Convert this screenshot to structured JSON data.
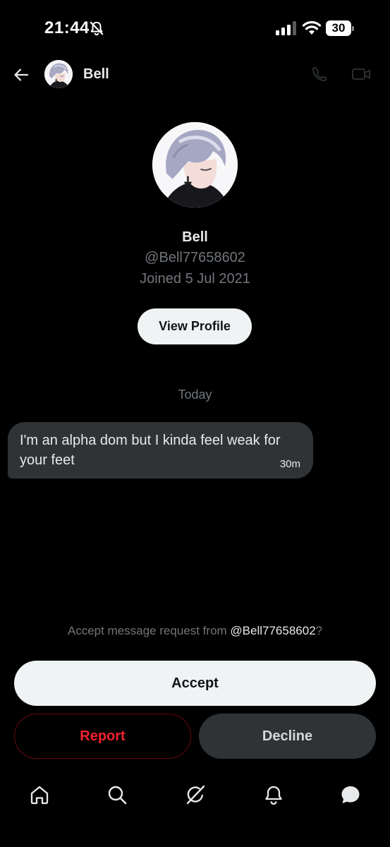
{
  "status_bar": {
    "time": "21:44",
    "battery": "30"
  },
  "header": {
    "name": "Bell"
  },
  "profile": {
    "name": "Bell",
    "handle": "@Bell77658602",
    "joined": "Joined 5 Jul 2021",
    "view_profile_label": "View Profile"
  },
  "conversation": {
    "date_separator": "Today",
    "messages": [
      {
        "text": "I'm an alpha dom but I kinda feel weak for your feet",
        "time": "30m"
      }
    ]
  },
  "request": {
    "prompt_prefix": "Accept message request from ",
    "handle": "@Bell77658602",
    "prompt_suffix": "?",
    "accept_label": "Accept",
    "report_label": "Report",
    "decline_label": "Decline"
  },
  "colors": {
    "background": "#000000",
    "bubble": "#2f3336",
    "muted_text": "#71767b",
    "report_red": "#f4212e"
  },
  "icons": {
    "status": [
      "mute-icon",
      "signal-icon",
      "wifi-icon"
    ],
    "header": [
      "back-arrow-icon",
      "phone-call-icon",
      "video-call-icon"
    ],
    "nav": [
      "home-icon",
      "search-icon",
      "grok-icon",
      "notifications-bell-icon",
      "messages-icon"
    ]
  }
}
